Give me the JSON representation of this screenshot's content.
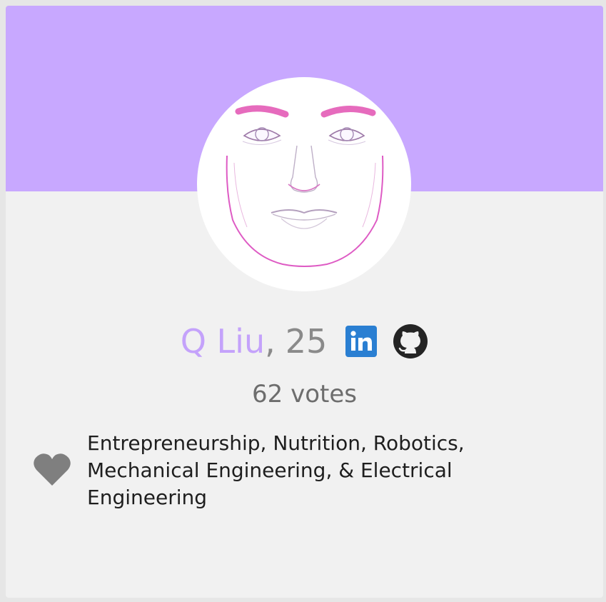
{
  "profile": {
    "name": "Q Liu",
    "separator": ",",
    "age": "25",
    "votes": "62 votes",
    "interests": "Entrepreneurship, Nutrition, Robotics, Mechanical Engineering, & Electrical Engineering",
    "social": {
      "linkedin_icon": "linkedin-icon",
      "github_icon": "github-icon"
    },
    "interest_icon": "heart-icon"
  },
  "colors": {
    "banner": "#c8a8ff",
    "card_background": "#f1f1f1",
    "name": "#c4a2fb",
    "age": "#8a8a8a",
    "votes": "#6d6d6d",
    "linkedin": "#2a7fd2",
    "github": "#242424",
    "heart": "#7f7f7f"
  }
}
